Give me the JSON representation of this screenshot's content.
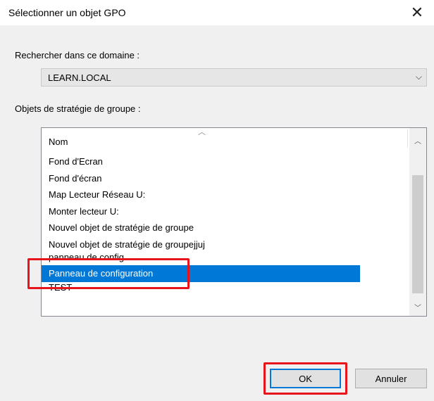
{
  "window": {
    "title": "Sélectionner un objet GPO",
    "close_glyph": "✕"
  },
  "domain_section": {
    "label": "Rechercher dans ce domaine :",
    "selected_value": "LEARN.LOCAL",
    "arrow_icon": "chevron-down-icon"
  },
  "gpo_section": {
    "label": "Objets de stratégie de groupe :",
    "column_header": "Nom",
    "items": [
      "Fond d'Ecran",
      "Fond d'écran",
      "Map Lecteur Réseau U:",
      "Monter lecteur U:",
      "Nouvel objet de stratégie de groupe",
      "Nouvel objet de stratégie de groupejjuj",
      "panneau de config",
      "Panneau de configuration",
      "TEST"
    ],
    "selected_index": 7
  },
  "buttons": {
    "ok": "OK",
    "cancel": "Annuler"
  },
  "colors": {
    "selection": "#0078d7",
    "highlight_annotation": "#e8141b"
  }
}
